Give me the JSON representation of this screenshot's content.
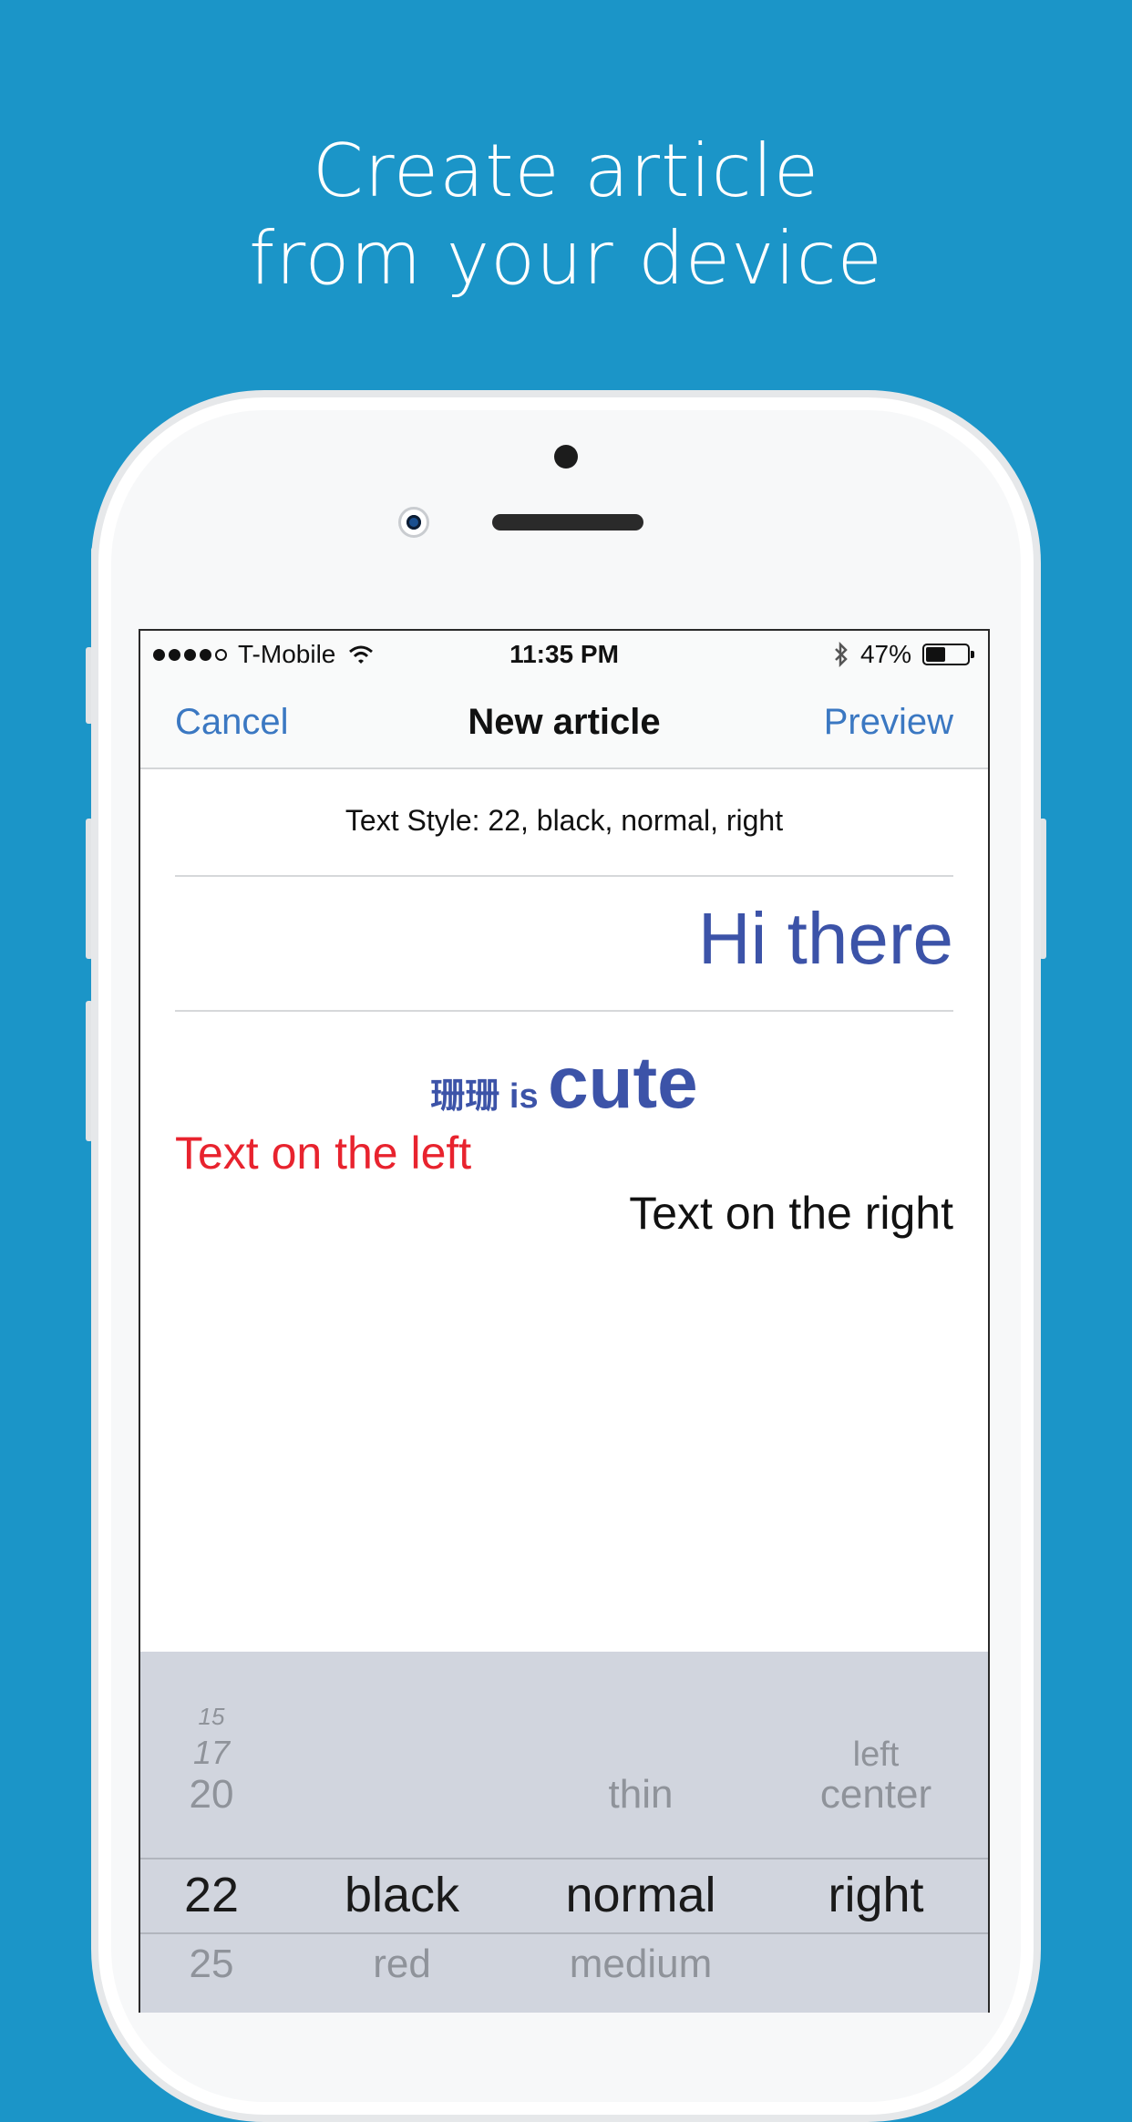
{
  "headline": {
    "line1": "Create article",
    "line2": "from your device"
  },
  "status_bar": {
    "carrier": "T-Mobile",
    "time": "11:35 PM",
    "battery_percent": "47%",
    "battery_level": 0.47,
    "signal_bars_filled": 4,
    "signal_bars_total": 5
  },
  "nav": {
    "cancel_label": "Cancel",
    "title": "New article",
    "preview_label": "Preview"
  },
  "editor": {
    "style_summary": "Text Style: 22, black, normal, right",
    "heading": "Hi there",
    "mixed_small": "珊珊 is ",
    "mixed_big": "cute",
    "text_left": "Text on the left",
    "text_right": "Text on the right"
  },
  "picker": {
    "size": {
      "above3": "15",
      "above2": "17",
      "above1": "20",
      "selected": "22",
      "below1": "25"
    },
    "color": {
      "selected": "black",
      "below1": "red"
    },
    "weight": {
      "above1": "thin",
      "selected": "normal",
      "below1": "medium"
    },
    "align": {
      "above2": "left",
      "above1": "center",
      "selected": "right"
    }
  },
  "colors": {
    "background": "#1b95c8",
    "ios_blue": "#3b78c2",
    "heading_blue": "#3c53a8",
    "red_text": "#e8232e",
    "picker_bg": "#d1d5de"
  }
}
